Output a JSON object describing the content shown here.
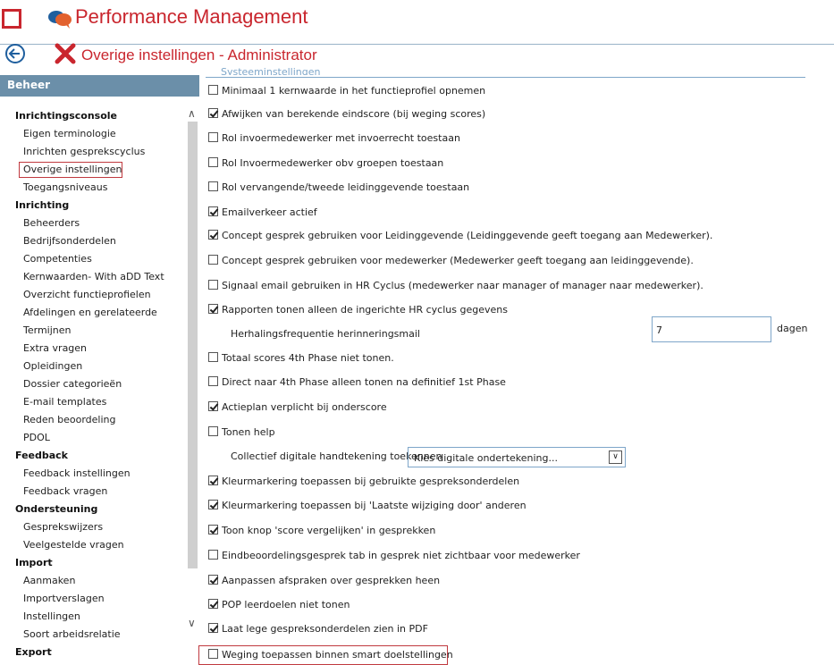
{
  "app": {
    "title": "Performance Management"
  },
  "page": {
    "title": "Overige instellingen - Administrator"
  },
  "sidebar": {
    "heading": "Beheer",
    "sections": [
      {
        "label": "Inrichtingsconsole",
        "items": [
          "Eigen terminologie",
          "Inrichten gesprekscyclus",
          "Overige instellingen",
          "Toegangsniveaus"
        ]
      },
      {
        "label": "Inrichting",
        "items": [
          "Beheerders",
          "Bedrijfsonderdelen",
          "Competenties",
          "Kernwaarden- With aDD Text",
          "Overzicht functieprofielen",
          "Afdelingen en gerelateerde",
          "Termijnen",
          "Extra vragen",
          "Opleidingen",
          "Dossier categorieën",
          "E-mail templates",
          "Reden beoordeling",
          "PDOL"
        ]
      },
      {
        "label": "Feedback",
        "items": [
          "Feedback instellingen",
          "Feedback vragen"
        ]
      },
      {
        "label": "Ondersteuning",
        "items": [
          "Gesprekswijzers",
          "Veelgestelde vragen"
        ]
      },
      {
        "label": "Import",
        "items": [
          "Aanmaken",
          "Importverslagen",
          "Instellingen",
          "Soort arbeidsrelatie"
        ]
      },
      {
        "label": "Export",
        "items": []
      }
    ],
    "selected": "Overige instellingen"
  },
  "settings": {
    "legend": "Systeeminstellingen",
    "rows": [
      {
        "type": "checkbox",
        "label": "Minimaal 1 kernwaarde in het functieprofiel opnemen",
        "checked": false
      },
      {
        "type": "checkbox",
        "label": "Afwijken van berekende eindscore (bij weging scores)",
        "checked": true
      },
      {
        "type": "checkbox",
        "label": "Rol invoermedewerker met invoerrecht toestaan",
        "checked": false
      },
      {
        "type": "checkbox",
        "label": "Rol Invoermedewerker obv groepen toestaan",
        "checked": false
      },
      {
        "type": "checkbox",
        "label": "Rol vervangende/tweede leidinggevende toestaan",
        "checked": false
      },
      {
        "type": "checkbox",
        "label": "Emailverkeer actief",
        "checked": true
      },
      {
        "type": "checkbox",
        "label": "Concept gesprek gebruiken voor Leidinggevende (Leidinggevende geeft toegang aan Medewerker).",
        "checked": true
      },
      {
        "type": "checkbox",
        "label": "Concept gesprek gebruiken voor medewerker (Medewerker geeft toegang aan leidinggevende).",
        "checked": false
      },
      {
        "type": "checkbox",
        "label": "Signaal email gebruiken in HR Cyclus (medewerker naar manager of manager naar medewerker).",
        "checked": false
      },
      {
        "type": "checkbox",
        "label": "Rapporten tonen alleen de ingerichte HR cyclus gegevens",
        "checked": true
      },
      {
        "type": "number",
        "label": "Herhalingsfrequentie herinneringsmail",
        "value": "7",
        "unit": "dagen"
      },
      {
        "type": "checkbox",
        "label": "Totaal scores 4th Phase niet tonen.",
        "checked": false
      },
      {
        "type": "checkbox",
        "label": "Direct naar 4th Phase alleen tonen na definitief 1st Phase",
        "checked": false
      },
      {
        "type": "checkbox",
        "label": "Actieplan verplicht bij onderscore",
        "checked": true
      },
      {
        "type": "checkbox",
        "label": "Tonen help",
        "checked": false
      },
      {
        "type": "select",
        "label": "Collectief digitale handtekening toekennen",
        "value": "Kies digitale ondertekening..."
      },
      {
        "type": "checkbox",
        "label": "Kleurmarkering toepassen bij gebruikte gespreksonderdelen",
        "checked": true
      },
      {
        "type": "checkbox",
        "label": "Kleurmarkering toepassen bij 'Laatste wijziging door' anderen",
        "checked": true
      },
      {
        "type": "checkbox",
        "label": "Toon knop 'score vergelijken' in gesprekken",
        "checked": true
      },
      {
        "type": "checkbox",
        "label": "Eindbeoordelingsgesprek tab in gesprek niet zichtbaar voor medewerker",
        "checked": false
      },
      {
        "type": "checkbox",
        "label": "Aanpassen afspraken over gesprekken heen",
        "checked": true
      },
      {
        "type": "checkbox",
        "label": "POP leerdoelen niet tonen",
        "checked": true
      },
      {
        "type": "checkbox",
        "label": "Laat lege gespreksonderdelen zien in PDF",
        "checked": true
      },
      {
        "type": "checkbox",
        "label": "Weging toepassen binnen smart doelstellingen",
        "checked": false,
        "highlight": true
      }
    ]
  },
  "colors": {
    "brand_red": "#c9262e",
    "sidebar_header": "#6b8fa9",
    "link_blue": "#1f5f9e",
    "highlight": "#c0393f"
  },
  "icons": {
    "app": "app-grid-icon",
    "logo": "chat-bubbles-icon",
    "back": "back-arrow-icon",
    "tools": "tools-cross-icon"
  }
}
